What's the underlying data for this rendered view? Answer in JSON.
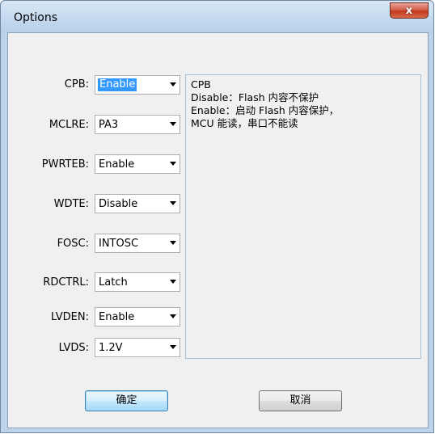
{
  "window": {
    "title": "Options",
    "close_glyph": "x"
  },
  "options": [
    {
      "key": "cpb",
      "label": "CPB:",
      "value": "Enable",
      "selected": true
    },
    {
      "key": "mclre",
      "label": "MCLRE:",
      "value": "PA3"
    },
    {
      "key": "pwrteb",
      "label": "PWRTEB:",
      "value": "Enable"
    },
    {
      "key": "wdte",
      "label": "WDTE:",
      "value": "Disable"
    },
    {
      "key": "fosc",
      "label": "FOSC:",
      "value": "INTOSC"
    },
    {
      "key": "rdctrl",
      "label": "RDCTRL:",
      "value": "Latch"
    },
    {
      "key": "lvden",
      "label": "LVDEN:",
      "value": "Enable"
    },
    {
      "key": "lvds",
      "label": "LVDS:",
      "value": "1.2V"
    }
  ],
  "description": {
    "lines": [
      "CPB",
      "Disable：Flash 内容不保护",
      "Enable：启动 Flash 内容保护，",
      "MCU 能读，串口不能读"
    ]
  },
  "buttons": {
    "ok_label": "确定",
    "cancel_label": "取消"
  },
  "colors": {
    "titlebar": "#c4d9ef",
    "client": "#f0f0f0",
    "close": "#c2391f",
    "selection": "#3399ff"
  }
}
